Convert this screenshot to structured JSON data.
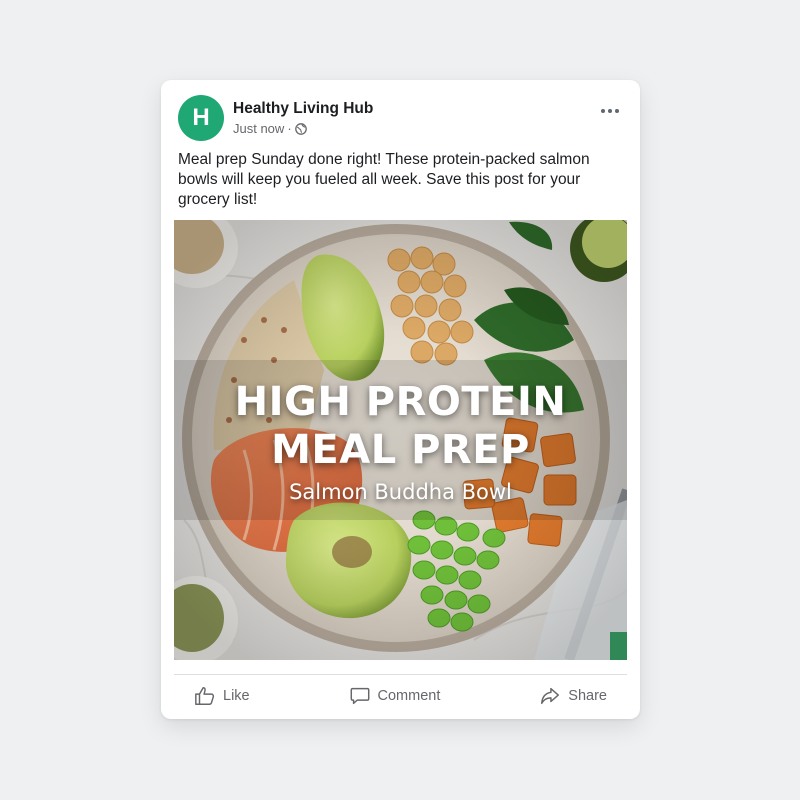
{
  "post": {
    "page_name": "Healthy Living Hub",
    "avatar_letter": "H",
    "timestamp": "Just now",
    "separator": "·",
    "caption": "Meal prep Sunday done right! These protein-packed salmon bowls will keep you fueled all week. Save this post for your grocery list!",
    "more_icon": "more-dots-icon",
    "privacy_icon": "globe-icon"
  },
  "image": {
    "title_line1": "HIGH PROTEIN",
    "title_line2": "MEAL PREP",
    "subtitle": "Salmon Buddha Bowl"
  },
  "actions": {
    "like_label": "Like",
    "comment_label": "Comment",
    "share_label": "Share"
  },
  "colors": {
    "avatar": "#1fa774",
    "text_primary": "#1c1e21",
    "text_secondary": "#65676b"
  }
}
